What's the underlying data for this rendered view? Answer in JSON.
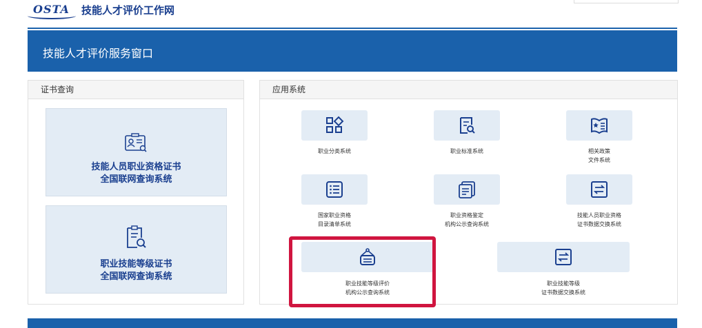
{
  "header": {
    "logo_text": "OSTA",
    "site_title": "技能人才评价工作网"
  },
  "banner": {
    "title": "技能人才评价服务窗口"
  },
  "left_panel": {
    "title": "证书查询",
    "cards": [
      {
        "icon": "id-card-search-icon",
        "line1": "技能人员职业资格证书",
        "line2": "全国联网查询系统"
      },
      {
        "icon": "document-search-icon",
        "line1": "职业技能等级证书",
        "line2": "全国联网查询系统"
      }
    ]
  },
  "right_panel": {
    "title": "应用系统",
    "apps": [
      {
        "icon": "category-grid-icon",
        "line1": "职业分类系统",
        "line2": ""
      },
      {
        "icon": "standard-search-icon",
        "line1": "职业标准系统",
        "line2": ""
      },
      {
        "icon": "policy-book-icon",
        "line1": "相关政策",
        "line2": "文件系统"
      },
      {
        "icon": "list-catalog-icon",
        "line1": "国家职业资格",
        "line2": "目录清单系统"
      },
      {
        "icon": "institution-docs-icon",
        "line1": "职业资格鉴定",
        "line2": "机构公示查询系统"
      },
      {
        "icon": "exchange-arrows-icon",
        "line1": "技能人员职业资格",
        "line2": "证书数据交换系统"
      },
      {
        "icon": "institution-sign-icon",
        "line1": "职业技能等级评价",
        "line2": "机构公示查询系统"
      },
      {
        "icon": "exchange-arrows-icon",
        "line1": "职业技能等级",
        "line2": "证书数据交换系统"
      }
    ]
  },
  "colors": {
    "brand_blue": "#1a61ab",
    "tile_bg": "#e3ecf5",
    "highlight_red": "#d0153f",
    "icon_blue": "#1a3f8f"
  }
}
